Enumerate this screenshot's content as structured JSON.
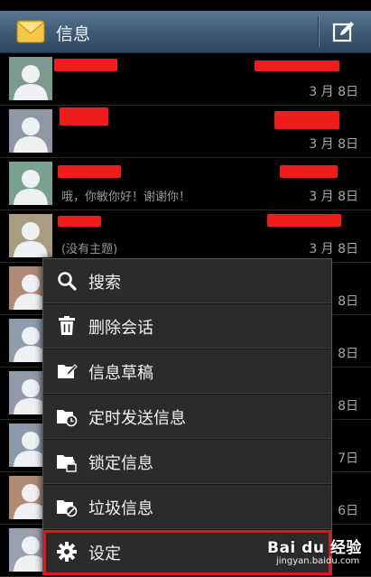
{
  "statusbar": {
    "text": ""
  },
  "header": {
    "title": "信息",
    "app_icon": "envelope-icon",
    "compose_icon": "compose-icon"
  },
  "conversations": [
    {
      "name": "",
      "snippet": "",
      "date": "3 月 8日",
      "avatar_color": "#7d9a8e"
    },
    {
      "name": "",
      "snippet": "",
      "date": "3 月 8日",
      "avatar_color": "#8d98a4"
    },
    {
      "name": "",
      "snippet": "哦，你敏你好！谢谢你！",
      "date": "3 月 8日",
      "avatar_color": "#7aa090"
    },
    {
      "name": "",
      "snippet": "(没有主题)",
      "date": "3 月 8日",
      "avatar_color": "#a89d80"
    },
    {
      "name": "",
      "snippet": "",
      "date": "8日",
      "avatar_color": "#b08a78"
    },
    {
      "name": "",
      "snippet": "",
      "date": "8日",
      "avatar_color": "#8e9cae"
    },
    {
      "name": "",
      "snippet": "",
      "date": "8日",
      "avatar_color": "#909aa8"
    },
    {
      "name": "",
      "snippet": "",
      "date": "7日",
      "avatar_color": "#8c98ac"
    },
    {
      "name": "",
      "snippet": "",
      "date": "6日",
      "avatar_color": "#b08a72"
    },
    {
      "name": "",
      "snippet": "",
      "date": "",
      "avatar_color": "#9aa0b0"
    }
  ],
  "menu": {
    "items": [
      {
        "label": "搜索",
        "icon": "search-icon"
      },
      {
        "label": "删除会话",
        "icon": "trash-icon"
      },
      {
        "label": "信息草稿",
        "icon": "draft-folder-icon"
      },
      {
        "label": "定时发送信息",
        "icon": "scheduled-folder-icon"
      },
      {
        "label": "锁定信息",
        "icon": "locked-folder-icon"
      },
      {
        "label": "垃圾信息",
        "icon": "spam-folder-icon"
      },
      {
        "label": "设定",
        "icon": "gear-icon"
      }
    ],
    "highlight_color": "#e0161c"
  },
  "watermark": {
    "brand": "Bai du 经验",
    "url": "jingyan.baidu.com"
  }
}
